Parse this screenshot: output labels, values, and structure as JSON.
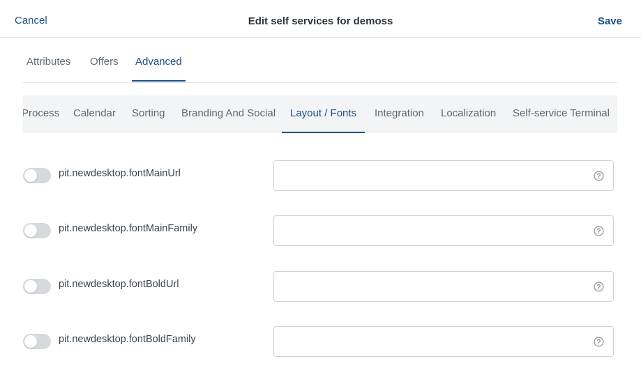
{
  "header": {
    "cancel_label": "Cancel",
    "title": "Edit self services for demoss",
    "save_label": "Save"
  },
  "main_tabs": [
    {
      "label": "Attributes",
      "active": false
    },
    {
      "label": "Offers",
      "active": false
    },
    {
      "label": "Advanced",
      "active": true
    }
  ],
  "sub_tabs": [
    {
      "label": "Process",
      "active": false
    },
    {
      "label": "Calendar",
      "active": false
    },
    {
      "label": "Sorting",
      "active": false
    },
    {
      "label": "Branding And Social",
      "active": false
    },
    {
      "label": "Layout / Fonts",
      "active": true
    },
    {
      "label": "Integration",
      "active": false
    },
    {
      "label": "Localization",
      "active": false
    },
    {
      "label": "Self-service Terminal",
      "active": false
    }
  ],
  "settings": [
    {
      "label": "pit.newdesktop.fontMainUrl",
      "enabled": false,
      "value": ""
    },
    {
      "label": "pit.newdesktop.fontMainFamily",
      "enabled": false,
      "value": ""
    },
    {
      "label": "pit.newdesktop.fontBoldUrl",
      "enabled": false,
      "value": ""
    },
    {
      "label": "pit.newdesktop.fontBoldFamily",
      "enabled": false,
      "value": ""
    }
  ],
  "icons": {
    "field_help": "help-circle-icon"
  },
  "colors": {
    "accent": "#1d4f8a",
    "subtab_bg": "#f3f4f6",
    "toggle_off": "#d6d9dd"
  }
}
